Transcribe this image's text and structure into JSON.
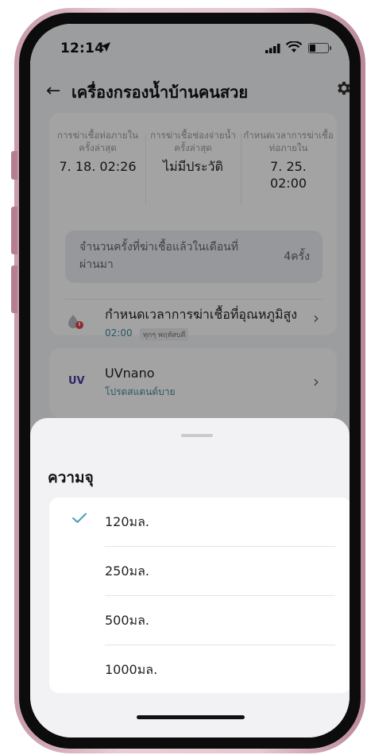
{
  "status_bar": {
    "time": "12:14"
  },
  "header": {
    "title": "เครื่องกรองน้ำบ้านคนสวย"
  },
  "stats": [
    {
      "label": "การฆ่าเชื้อท่อภายในครั้งล่าสุด",
      "value": "7. 18. 02:26"
    },
    {
      "label": "การฆ่าเชื้อช่องจ่ายน้ำครั้งล่าสุด",
      "value": "ไม่มีประวัติ"
    },
    {
      "label": "กำหนดเวลาการฆ่าเชื้อท่อภายใน",
      "value": "7. 25. 02:00"
    }
  ],
  "count": {
    "label": "จำนวนครั้งที่ฆ่าเชื้อแล้วในเดือนที่ผ่านมา",
    "value": "4ครั้ง"
  },
  "schedule": {
    "title": "กำหนดเวลาการฆ่าเชื้อที่อุณหภูมิสูง",
    "time": "02:00",
    "badge": "ทุกๆ พฤหัสบดี"
  },
  "uv": {
    "icon_label": "UV",
    "title": "UVnano",
    "subtitle": "โปรดสแตนด์บาย"
  },
  "sheet": {
    "title": "ความจุ",
    "options": [
      {
        "label": "120มล.",
        "selected": true
      },
      {
        "label": "250มล.",
        "selected": false
      },
      {
        "label": "500มล.",
        "selected": false
      },
      {
        "label": "1000มล.",
        "selected": false
      }
    ]
  },
  "colors": {
    "accent": "#3f8a96",
    "check": "#4a9cb8"
  }
}
